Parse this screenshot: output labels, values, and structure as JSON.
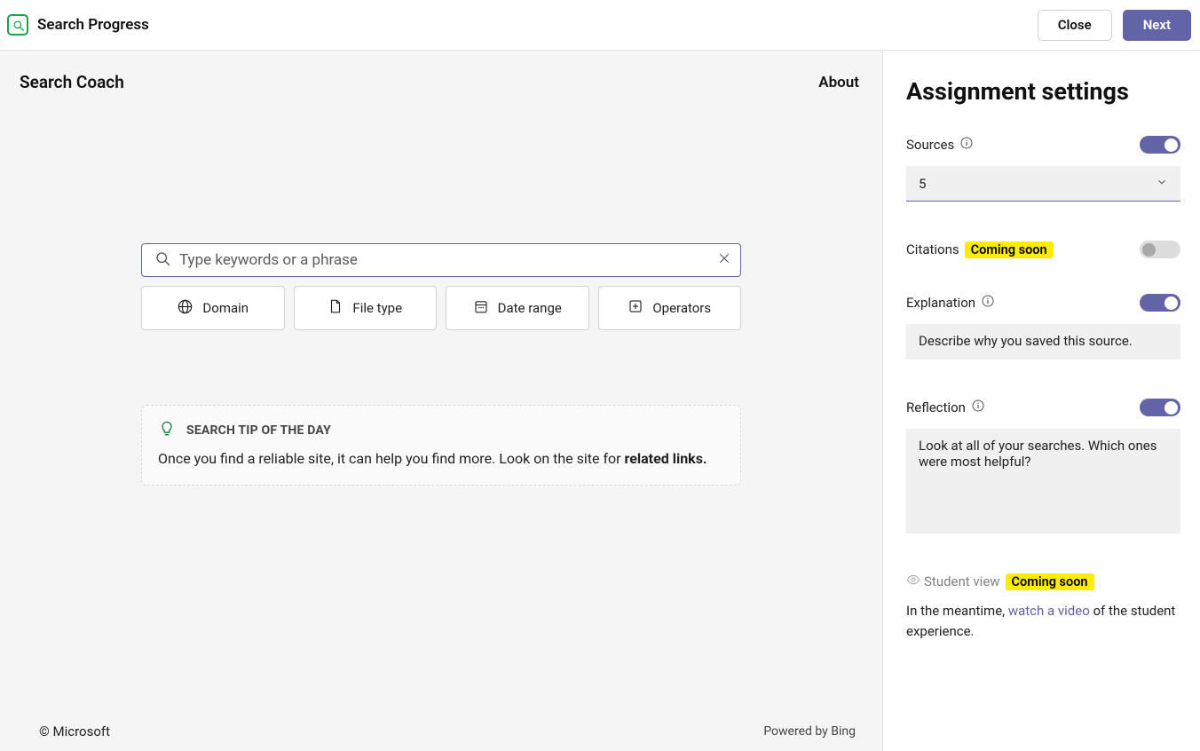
{
  "titlebar": {
    "title": "Search Progress",
    "close_label": "Close",
    "next_label": "Next"
  },
  "main": {
    "title": "Search Coach",
    "about_label": "About",
    "search_placeholder": "Type keywords or a phrase",
    "filters": {
      "domain": "Domain",
      "filetype": "File type",
      "daterange": "Date range",
      "operators": "Operators"
    },
    "tip": {
      "heading": "SEARCH TIP OF THE DAY",
      "text_pre": "Once you find a reliable site, it can help you find more. Look on the site for ",
      "text_bold": "related links."
    },
    "footer_left": "© Microsoft",
    "footer_right": "Powered by Bing"
  },
  "sidebar": {
    "title": "Assignment settings",
    "sources_label": "Sources",
    "sources_value": "5",
    "citations_label": "Citations",
    "coming_soon": "Coming soon",
    "explanation_label": "Explanation",
    "explanation_text": "Describe why you saved this source.",
    "reflection_label": "Reflection",
    "reflection_text": "Look at all of your searches. Which ones were most helpful?",
    "student_view_label": "Student view",
    "helper_pre": "In the meantime, ",
    "helper_link": "watch a video",
    "helper_post": " of the student experience."
  }
}
